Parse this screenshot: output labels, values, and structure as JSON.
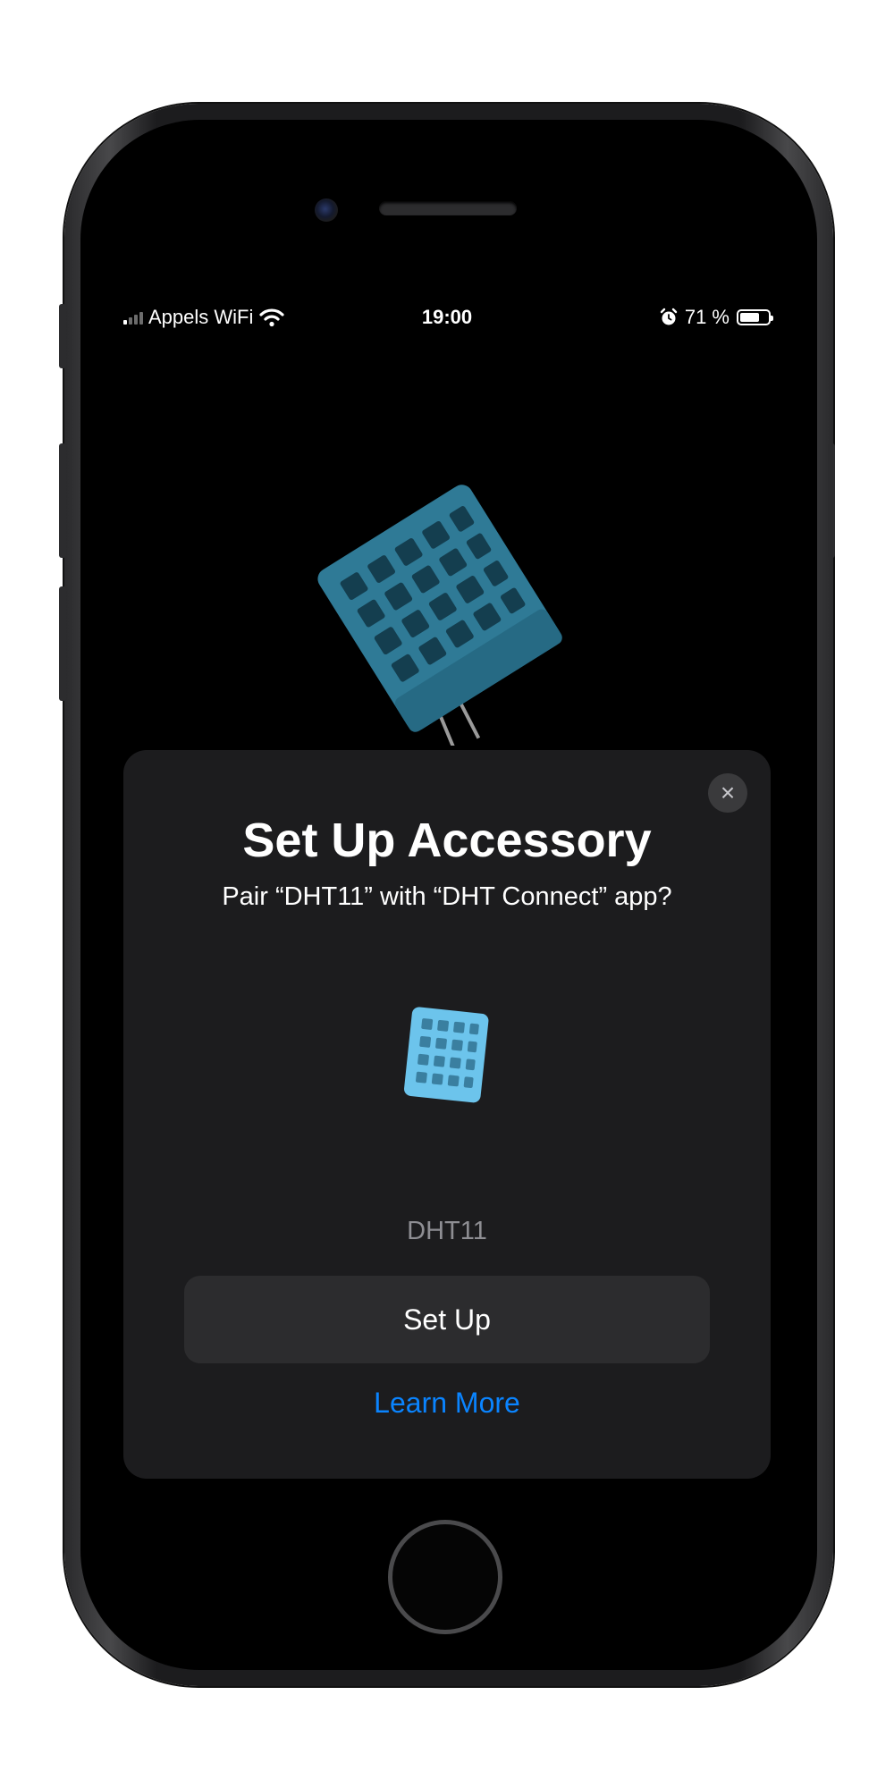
{
  "status_bar": {
    "carrier": "Appels WiFi",
    "time": "19:00",
    "battery_percent": "71 %",
    "battery_level": 0.71,
    "icons": [
      "signal-icon",
      "wifi-icon",
      "alarm-icon",
      "battery-icon"
    ]
  },
  "sheet": {
    "title": "Set Up Accessory",
    "subtitle": "Pair “DHT11” with “DHT Connect” app?",
    "close_icon": "×",
    "device_name": "DHT11",
    "setup_label": "Set Up",
    "learn_more_label": "Learn More"
  },
  "colors": {
    "sheet_background": "#1c1c1e",
    "button_background": "#2c2c2e",
    "link": "#0a84ff",
    "sensor_dark": "#2f7a96",
    "sensor_light": "#6cc4ec"
  }
}
